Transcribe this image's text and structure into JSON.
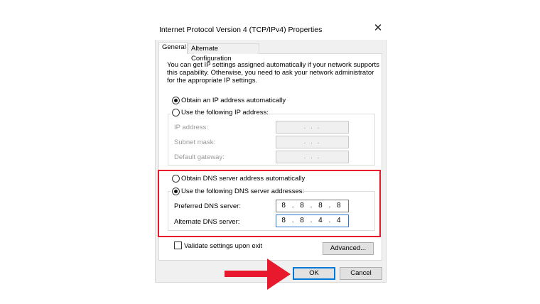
{
  "window": {
    "title": "Internet Protocol Version 4 (TCP/IPv4) Properties",
    "close_glyph": "✕"
  },
  "tabs": [
    {
      "label": "General",
      "selected": true
    },
    {
      "label": "Alternate Configuration",
      "selected": false
    }
  ],
  "intro_text": "You can get IP settings assigned automatically if your network supports this capability. Otherwise, you need to ask your network administrator for the appropriate IP settings.",
  "ip_section": {
    "obtain_auto_label": "Obtain an IP address automatically",
    "use_following_label": "Use the following IP address:",
    "selected": "obtain_auto",
    "fields": [
      {
        "label": "IP address:",
        "value": ".   .   ."
      },
      {
        "label": "Subnet mask:",
        "value": ".   .   ."
      },
      {
        "label": "Default gateway:",
        "value": ".   .   ."
      }
    ]
  },
  "dns_section": {
    "obtain_auto_label": "Obtain DNS server address automatically",
    "use_following_label": "Use the following DNS server addresses:",
    "selected": "use_following",
    "preferred_label": "Preferred DNS server:",
    "preferred_value": "8 . 8 . 8 . 8",
    "alternate_label": "Alternate DNS server:",
    "alternate_value": "8 . 8 . 4 . 4"
  },
  "validate_label": "Validate settings upon exit",
  "validate_checked": false,
  "buttons": {
    "advanced": "Advanced...",
    "ok": "OK",
    "cancel": "Cancel"
  },
  "colors": {
    "highlight": "#e8192c",
    "arrow": "#e8192c",
    "focus": "#0078d7"
  },
  "icons": {
    "close": "close-icon",
    "arrow": "arrow-right-icon"
  }
}
